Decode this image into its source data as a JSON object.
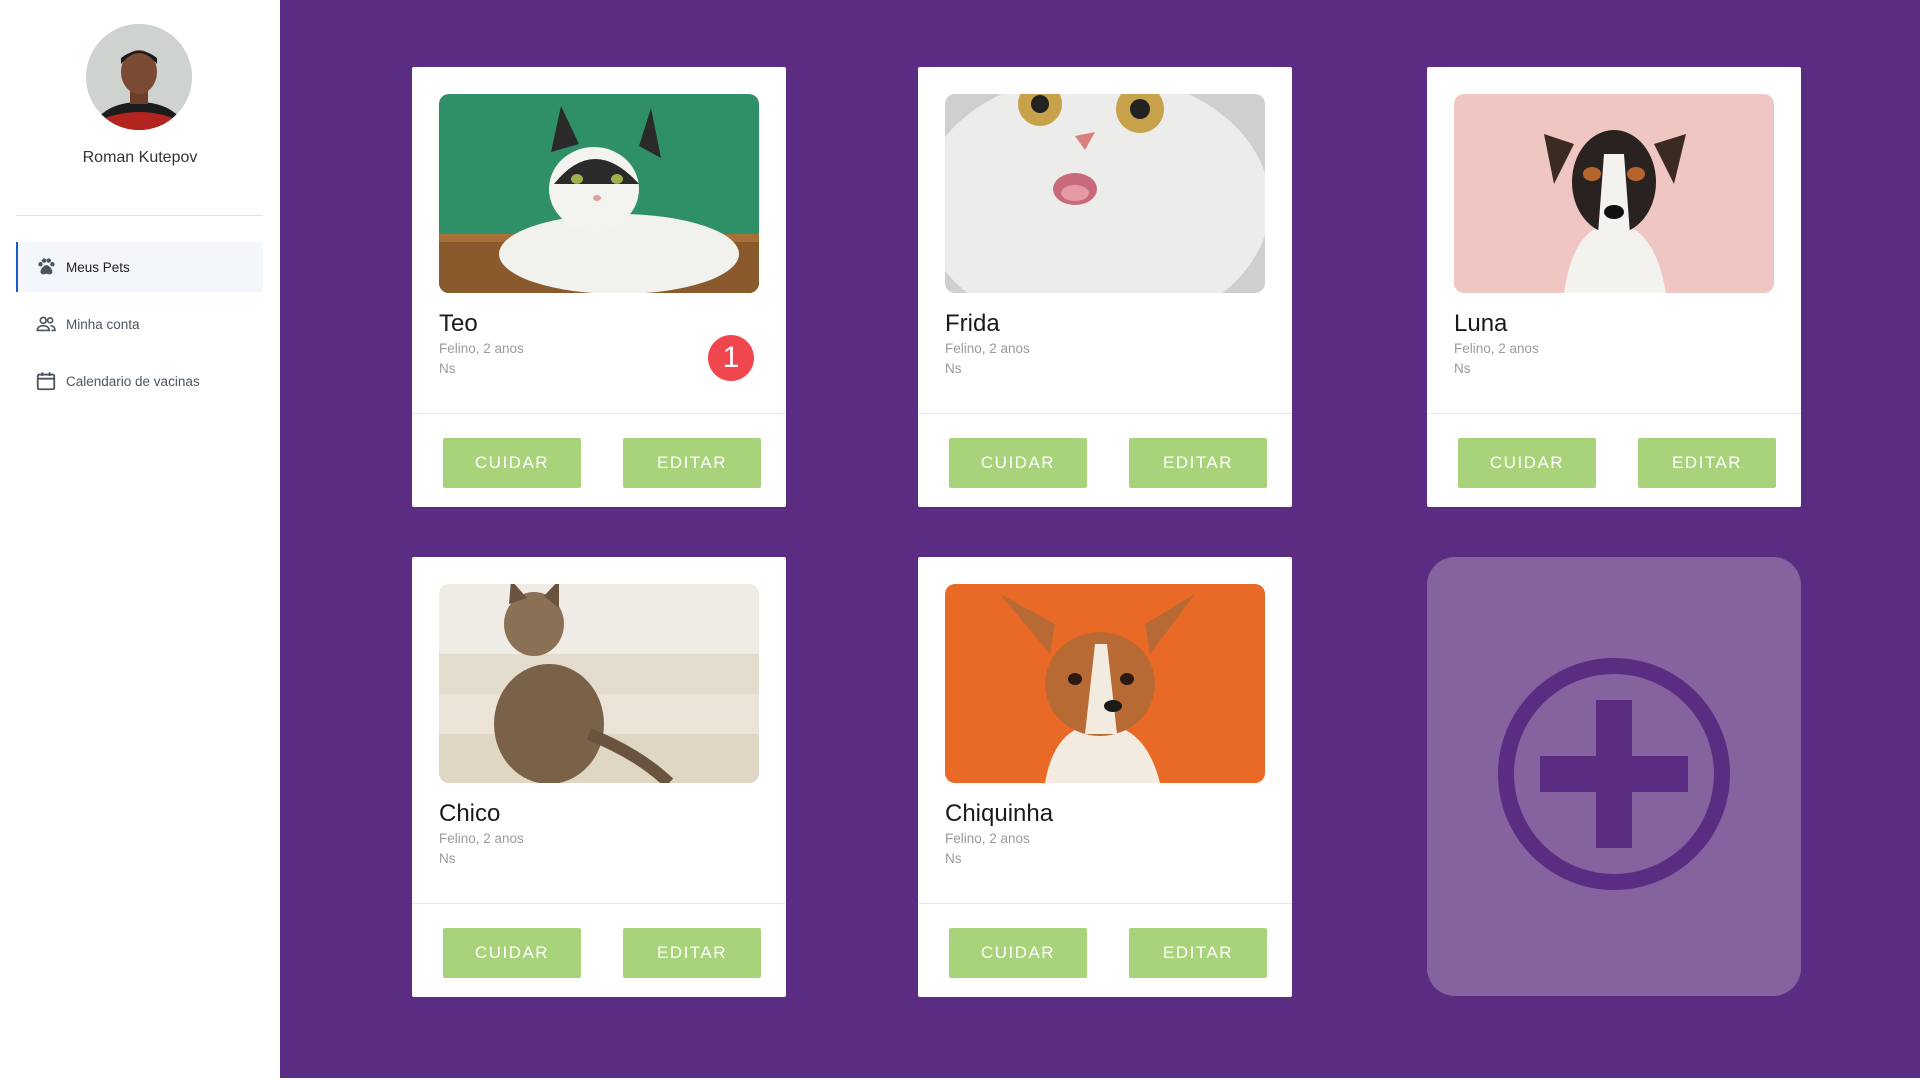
{
  "user": {
    "name": "Roman Kutepov"
  },
  "nav": {
    "items": [
      {
        "label": "Meus Pets",
        "icon": "paw-icon",
        "active": true
      },
      {
        "label": "Minha conta",
        "icon": "people-icon",
        "active": false
      },
      {
        "label": "Calendario de vacinas",
        "icon": "calendar-icon",
        "active": false
      }
    ]
  },
  "pets": [
    {
      "name": "Teo",
      "info": "Felino, 2 anos",
      "note": "Ns",
      "badge": "1",
      "photo": "cat-on-green-background"
    },
    {
      "name": "Frida",
      "info": "Felino, 2 anos",
      "note": "Ns",
      "photo": "white-cat-closeup"
    },
    {
      "name": "Luna",
      "info": "Felino, 2 anos",
      "note": "Ns",
      "photo": "dog-on-pink-background"
    },
    {
      "name": "Chico",
      "info": "Felino, 2 anos",
      "note": "Ns",
      "photo": "tabby-cat-on-stairs"
    },
    {
      "name": "Chiquinha",
      "info": "Felino, 2 anos",
      "note": "Ns",
      "photo": "corgi-on-orange-background"
    }
  ],
  "actions": {
    "care_label": "CUIDAR",
    "edit_label": "EDITAR"
  },
  "add_card": {
    "icon": "plus-circle-icon"
  },
  "colors": {
    "main_bg": "#5a2d82",
    "add_card_bg": "#85639f",
    "button_green": "#a8d37b",
    "badge_red": "#f0474f",
    "active_nav_border": "#1d5cc4"
  }
}
